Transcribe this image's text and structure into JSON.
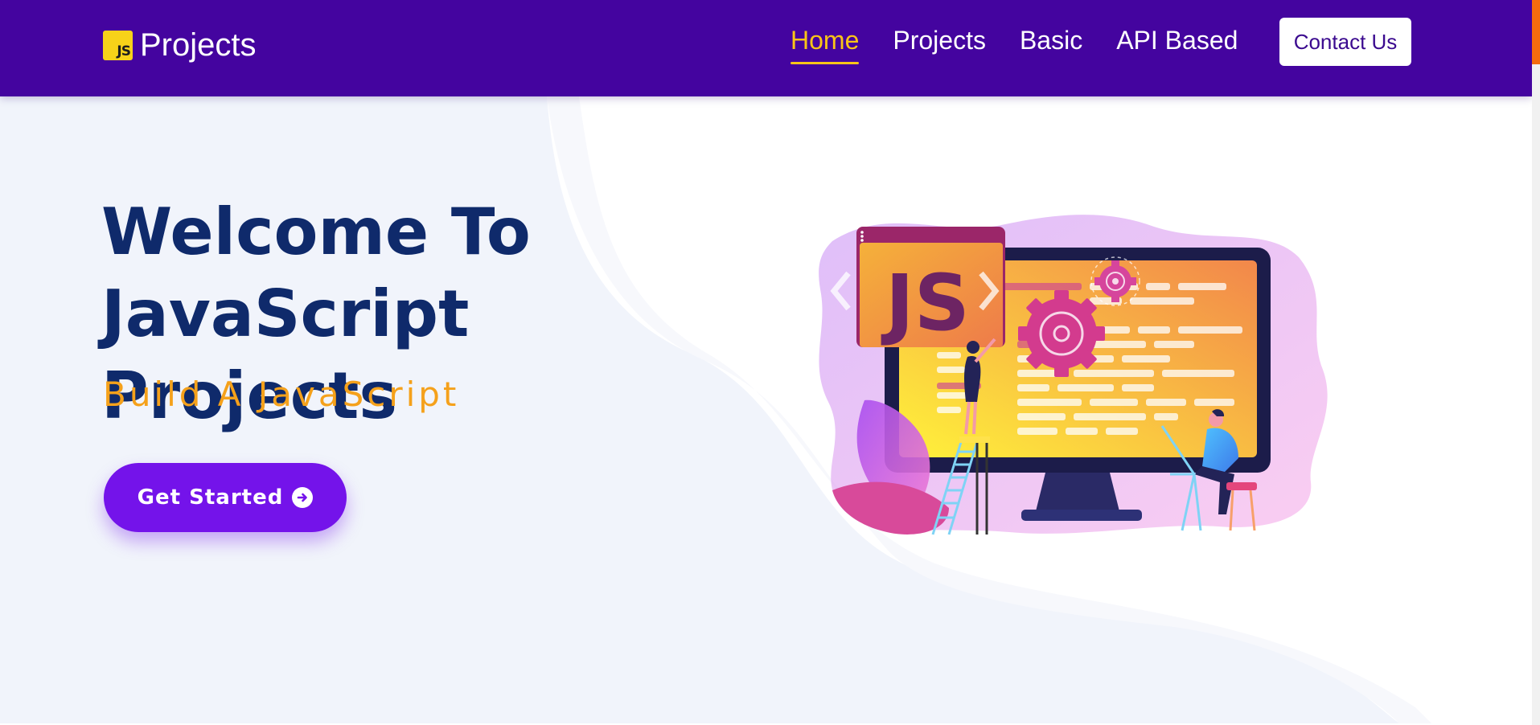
{
  "navbar": {
    "brand_logo_text": "JS",
    "brand_text": "Projects",
    "links": [
      {
        "label": "Home",
        "active": true
      },
      {
        "label": "Projects",
        "active": false
      },
      {
        "label": "Basic",
        "active": false
      },
      {
        "label": "API Based",
        "active": false
      }
    ],
    "contact_label": "Contact Us"
  },
  "hero": {
    "title_line1": "Welcome To",
    "title_line2": "JavaScript Projects",
    "subtitle": "Build A JavaScript",
    "cta_label": "Get Started",
    "cta_icon": "arrow-circle-right-icon",
    "illustration_text": "JS",
    "illustration": "developers-building-javascript-illustration"
  },
  "colors": {
    "navbar": "#44049f",
    "active_link": "#f9c418",
    "title": "#0f2a6b",
    "subtitle": "#f5a11b",
    "cta": "#7413ea"
  }
}
